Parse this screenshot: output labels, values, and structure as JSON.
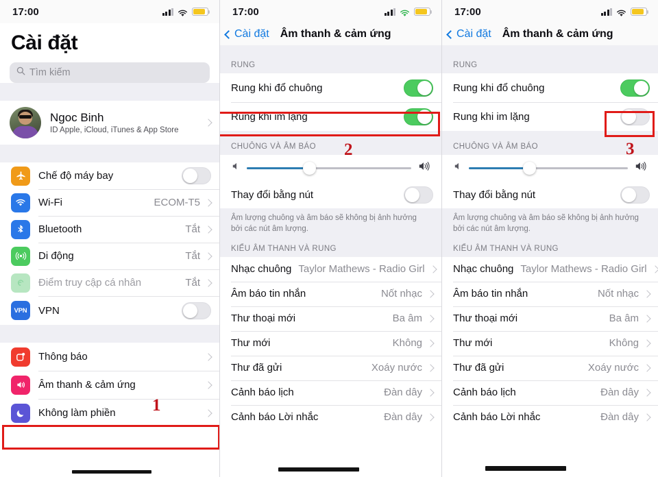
{
  "status_bar": {
    "time": "17:00",
    "signal_icon": "cellular-signal-icon",
    "wifi_icon": "wifi-icon",
    "battery_icon": "battery-icon"
  },
  "colors": {
    "accent_blue": "#1179e0",
    "toggle_on_green": "#4ccb5f",
    "annotation_red": "#e01b18",
    "slider_fill": "#2d7db2",
    "battery_yellow": "#f4c61e",
    "group_bg": "#efeff4"
  },
  "panel1": {
    "title": "Cài đặt",
    "search": {
      "placeholder": "Tìm kiếm",
      "icon": "search-icon"
    },
    "account": {
      "name": "Ngoc Binh",
      "subtitle": "ID Apple, iCloud, iTunes & App Store",
      "avatar_name": "user-avatar"
    },
    "group_a": [
      {
        "label": "Chế độ máy bay",
        "icon": "airplane-icon",
        "icon_color": "#f09a18",
        "control": "toggle",
        "on": false
      },
      {
        "label": "Wi-Fi",
        "icon": "wifi-icon",
        "icon_color": "#2a78e8",
        "control": "value",
        "value": "ECOM-T5"
      },
      {
        "label": "Bluetooth",
        "icon": "bluetooth-icon",
        "icon_color": "#2a78e8",
        "control": "value",
        "value": "Tắt"
      },
      {
        "label": "Di động",
        "icon": "cellular-icon",
        "icon_color": "#4ccb5f",
        "control": "value",
        "value": "Tắt"
      },
      {
        "label": "Điểm truy cập cá nhân",
        "icon": "hotspot-icon",
        "icon_color": "#b7e6c1",
        "control": "value",
        "value": "Tắt",
        "dimmed": true
      },
      {
        "label": "VPN",
        "icon": "vpn-icon",
        "icon_color": "#2a6fe0",
        "control": "toggle",
        "on": false,
        "icon_text": "VPN"
      }
    ],
    "group_b": [
      {
        "label": "Thông báo",
        "icon": "notifications-icon",
        "icon_color": "#f03b2e",
        "control": "chevron"
      },
      {
        "label": "Âm thanh & cảm ứng",
        "icon": "sounds-haptics-icon",
        "icon_color": "#f0246a",
        "control": "chevron",
        "highlighted": true
      },
      {
        "label": "Không làm phiền",
        "icon": "do-not-disturb-icon",
        "icon_color": "#5b55d6",
        "control": "chevron"
      }
    ]
  },
  "panel2": {
    "nav": {
      "back_label": "Cài đặt",
      "title": "Âm thanh & cảm ứng"
    },
    "section_vibrate": {
      "header": "RUNG"
    },
    "vibrate_rows": [
      {
        "label": "Rung khi đổ chuông",
        "on": true
      },
      {
        "label": "Rung khi im lặng",
        "on": true,
        "highlighted": true
      }
    ],
    "section_ringer": {
      "header": "CHUÔNG VÀ ÂM BÁO",
      "slider_percent": 38,
      "speaker_low_icon": "speaker-low-icon",
      "speaker_high_icon": "speaker-high-icon",
      "change_with_buttons": {
        "label": "Thay đổi bằng nút",
        "on": false
      },
      "footer": "Âm lượng chuông và âm báo sẽ không bị ảnh hưởng bởi các nút âm lượng."
    },
    "section_sounds": {
      "header": "KIỂU ÂM THANH VÀ RUNG",
      "rows": [
        {
          "label": "Nhạc chuông",
          "value": "Taylor Mathews - Radio Girl"
        },
        {
          "label": "Âm báo tin nhắn",
          "value": "Nốt nhạc"
        },
        {
          "label": "Thư thoại mới",
          "value": "Ba âm"
        },
        {
          "label": "Thư mới",
          "value": "Không"
        },
        {
          "label": "Thư đã gửi",
          "value": "Xoáy nước"
        },
        {
          "label": "Cảnh báo lịch",
          "value": "Đàn dây"
        },
        {
          "label": "Cảnh báo Lời nhắc",
          "value": "Đàn dây"
        }
      ]
    }
  },
  "panel3": {
    "nav": {
      "back_label": "Cài đặt",
      "title": "Âm thanh & cảm ứng"
    },
    "section_vibrate": {
      "header": "RUNG"
    },
    "vibrate_rows": [
      {
        "label": "Rung khi đổ chuông",
        "on": true
      },
      {
        "label": "Rung khi im lặng",
        "on": false,
        "highlighted": true
      }
    ],
    "section_ringer": {
      "header": "CHUÔNG VÀ ÂM BÁO",
      "slider_percent": 38,
      "change_with_buttons": {
        "label": "Thay đổi bằng nút",
        "on": false
      },
      "footer": "Âm lượng chuông và âm báo sẽ không bị ảnh hưởng bởi các nút âm lượng."
    },
    "section_sounds": {
      "header": "KIỂU ÂM THANH VÀ RUNG",
      "rows": [
        {
          "label": "Nhạc chuông",
          "value": "Taylor Mathews - Radio Girl"
        },
        {
          "label": "Âm báo tin nhắn",
          "value": "Nốt nhạc"
        },
        {
          "label": "Thư thoại mới",
          "value": "Ba âm"
        },
        {
          "label": "Thư mới",
          "value": "Không"
        },
        {
          "label": "Thư đã gửi",
          "value": "Xoáy nước"
        },
        {
          "label": "Cảnh báo lịch",
          "value": "Đàn dây"
        },
        {
          "label": "Cảnh báo Lời nhắc",
          "value": "Đàn dây"
        }
      ]
    }
  },
  "annotations": [
    {
      "number": "1",
      "target": "sounds-haptics-row-panel1"
    },
    {
      "number": "2",
      "target": "vibrate-on-silent-row-panel2"
    },
    {
      "number": "3",
      "target": "vibrate-on-silent-toggle-panel3"
    }
  ]
}
